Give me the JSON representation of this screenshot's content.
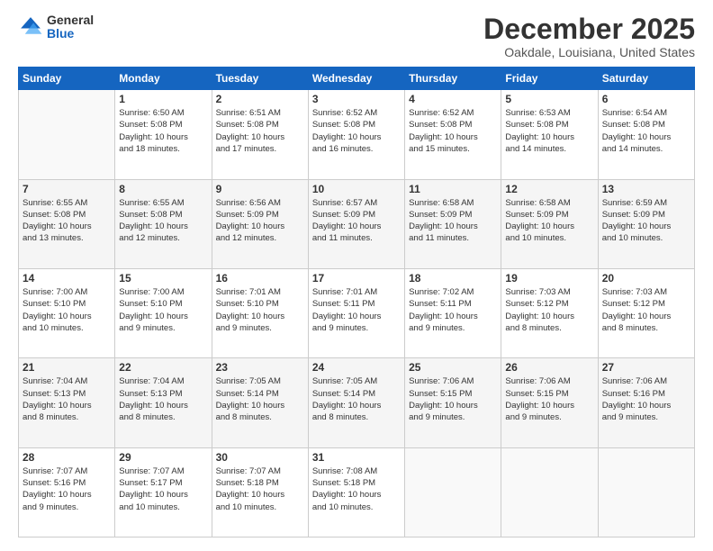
{
  "logo": {
    "general": "General",
    "blue": "Blue"
  },
  "title": "December 2025",
  "subtitle": "Oakdale, Louisiana, United States",
  "days_of_week": [
    "Sunday",
    "Monday",
    "Tuesday",
    "Wednesday",
    "Thursday",
    "Friday",
    "Saturday"
  ],
  "weeks": [
    [
      {
        "day": "",
        "info": ""
      },
      {
        "day": "1",
        "info": "Sunrise: 6:50 AM\nSunset: 5:08 PM\nDaylight: 10 hours\nand 18 minutes."
      },
      {
        "day": "2",
        "info": "Sunrise: 6:51 AM\nSunset: 5:08 PM\nDaylight: 10 hours\nand 17 minutes."
      },
      {
        "day": "3",
        "info": "Sunrise: 6:52 AM\nSunset: 5:08 PM\nDaylight: 10 hours\nand 16 minutes."
      },
      {
        "day": "4",
        "info": "Sunrise: 6:52 AM\nSunset: 5:08 PM\nDaylight: 10 hours\nand 15 minutes."
      },
      {
        "day": "5",
        "info": "Sunrise: 6:53 AM\nSunset: 5:08 PM\nDaylight: 10 hours\nand 14 minutes."
      },
      {
        "day": "6",
        "info": "Sunrise: 6:54 AM\nSunset: 5:08 PM\nDaylight: 10 hours\nand 14 minutes."
      }
    ],
    [
      {
        "day": "7",
        "info": "Sunrise: 6:55 AM\nSunset: 5:08 PM\nDaylight: 10 hours\nand 13 minutes."
      },
      {
        "day": "8",
        "info": "Sunrise: 6:55 AM\nSunset: 5:08 PM\nDaylight: 10 hours\nand 12 minutes."
      },
      {
        "day": "9",
        "info": "Sunrise: 6:56 AM\nSunset: 5:09 PM\nDaylight: 10 hours\nand 12 minutes."
      },
      {
        "day": "10",
        "info": "Sunrise: 6:57 AM\nSunset: 5:09 PM\nDaylight: 10 hours\nand 11 minutes."
      },
      {
        "day": "11",
        "info": "Sunrise: 6:58 AM\nSunset: 5:09 PM\nDaylight: 10 hours\nand 11 minutes."
      },
      {
        "day": "12",
        "info": "Sunrise: 6:58 AM\nSunset: 5:09 PM\nDaylight: 10 hours\nand 10 minutes."
      },
      {
        "day": "13",
        "info": "Sunrise: 6:59 AM\nSunset: 5:09 PM\nDaylight: 10 hours\nand 10 minutes."
      }
    ],
    [
      {
        "day": "14",
        "info": "Sunrise: 7:00 AM\nSunset: 5:10 PM\nDaylight: 10 hours\nand 10 minutes."
      },
      {
        "day": "15",
        "info": "Sunrise: 7:00 AM\nSunset: 5:10 PM\nDaylight: 10 hours\nand 9 minutes."
      },
      {
        "day": "16",
        "info": "Sunrise: 7:01 AM\nSunset: 5:10 PM\nDaylight: 10 hours\nand 9 minutes."
      },
      {
        "day": "17",
        "info": "Sunrise: 7:01 AM\nSunset: 5:11 PM\nDaylight: 10 hours\nand 9 minutes."
      },
      {
        "day": "18",
        "info": "Sunrise: 7:02 AM\nSunset: 5:11 PM\nDaylight: 10 hours\nand 9 minutes."
      },
      {
        "day": "19",
        "info": "Sunrise: 7:03 AM\nSunset: 5:12 PM\nDaylight: 10 hours\nand 8 minutes."
      },
      {
        "day": "20",
        "info": "Sunrise: 7:03 AM\nSunset: 5:12 PM\nDaylight: 10 hours\nand 8 minutes."
      }
    ],
    [
      {
        "day": "21",
        "info": "Sunrise: 7:04 AM\nSunset: 5:13 PM\nDaylight: 10 hours\nand 8 minutes."
      },
      {
        "day": "22",
        "info": "Sunrise: 7:04 AM\nSunset: 5:13 PM\nDaylight: 10 hours\nand 8 minutes."
      },
      {
        "day": "23",
        "info": "Sunrise: 7:05 AM\nSunset: 5:14 PM\nDaylight: 10 hours\nand 8 minutes."
      },
      {
        "day": "24",
        "info": "Sunrise: 7:05 AM\nSunset: 5:14 PM\nDaylight: 10 hours\nand 8 minutes."
      },
      {
        "day": "25",
        "info": "Sunrise: 7:06 AM\nSunset: 5:15 PM\nDaylight: 10 hours\nand 9 minutes."
      },
      {
        "day": "26",
        "info": "Sunrise: 7:06 AM\nSunset: 5:15 PM\nDaylight: 10 hours\nand 9 minutes."
      },
      {
        "day": "27",
        "info": "Sunrise: 7:06 AM\nSunset: 5:16 PM\nDaylight: 10 hours\nand 9 minutes."
      }
    ],
    [
      {
        "day": "28",
        "info": "Sunrise: 7:07 AM\nSunset: 5:16 PM\nDaylight: 10 hours\nand 9 minutes."
      },
      {
        "day": "29",
        "info": "Sunrise: 7:07 AM\nSunset: 5:17 PM\nDaylight: 10 hours\nand 10 minutes."
      },
      {
        "day": "30",
        "info": "Sunrise: 7:07 AM\nSunset: 5:18 PM\nDaylight: 10 hours\nand 10 minutes."
      },
      {
        "day": "31",
        "info": "Sunrise: 7:08 AM\nSunset: 5:18 PM\nDaylight: 10 hours\nand 10 minutes."
      },
      {
        "day": "",
        "info": ""
      },
      {
        "day": "",
        "info": ""
      },
      {
        "day": "",
        "info": ""
      }
    ]
  ]
}
